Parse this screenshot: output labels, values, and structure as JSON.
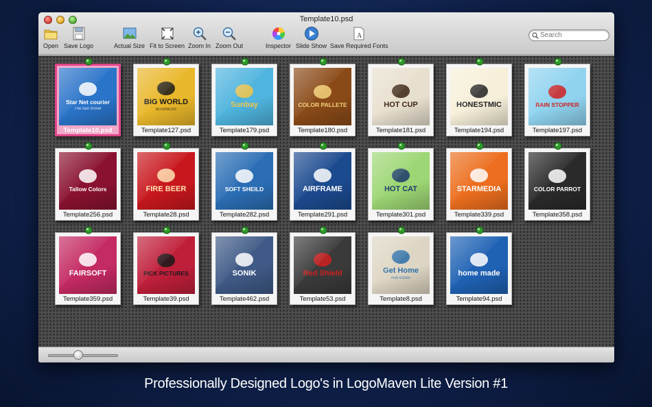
{
  "window": {
    "title": "Template10.psd"
  },
  "toolbar": {
    "buttons": [
      {
        "label": "Open",
        "icon": "folder-icon"
      },
      {
        "label": "Save Logo",
        "icon": "save-icon"
      },
      {
        "label": "Actual Size",
        "icon": "actual-size-icon"
      },
      {
        "label": "Fit to Screen",
        "icon": "fit-screen-icon"
      },
      {
        "label": "Zoom In",
        "icon": "zoom-in-icon"
      },
      {
        "label": "Zoom Out",
        "icon": "zoom-out-icon"
      },
      {
        "label": "Inspector",
        "icon": "color-wheel-icon"
      },
      {
        "label": "Slide Show",
        "icon": "play-icon"
      },
      {
        "label": "Save Required Fonts",
        "icon": "font-document-icon"
      }
    ]
  },
  "search": {
    "placeholder": "Search"
  },
  "templates": [
    {
      "file": "Template10.psd",
      "logo": "Star Net courier",
      "tagline": "The fast mover",
      "bg": "#2a74c9",
      "fg": "#ffffff",
      "selected": true
    },
    {
      "file": "Template127.psd",
      "logo": "BIG WORLD",
      "tagline": "BUSINESS",
      "bg": "#e9b72a",
      "fg": "#1b1b1b"
    },
    {
      "file": "Template179.psd",
      "logo": "Sunbay",
      "tagline": "",
      "bg": "#4fb4de",
      "fg": "#f2c54a"
    },
    {
      "file": "Template180.psd",
      "logo": "COLOR PALLETE",
      "tagline": "",
      "bg": "#8a4a18",
      "fg": "#f5d27a"
    },
    {
      "file": "Template181.psd",
      "logo": "HOT CUP",
      "tagline": "",
      "bg": "#e8e0cf",
      "fg": "#3b2414"
    },
    {
      "file": "Template194.psd",
      "logo": "HONESTMIC",
      "tagline": "",
      "bg": "#f6efd9",
      "fg": "#222222"
    },
    {
      "file": "Template197.psd",
      "logo": "RAIN STOPPER",
      "tagline": "",
      "bg": "#8fd3ef",
      "fg": "#d02020"
    },
    {
      "file": "Template256.psd",
      "logo": "Tallow Colors",
      "tagline": "",
      "bg": "#8a1230",
      "fg": "#ffffff"
    },
    {
      "file": "Template28.psd",
      "logo": "FIRE BEER",
      "tagline": "",
      "bg": "#c8181e",
      "fg": "#ffe2b0"
    },
    {
      "file": "Template282.psd",
      "logo": "SOFT SHEILD",
      "tagline": "",
      "bg": "#2b6eb5",
      "fg": "#ffffff"
    },
    {
      "file": "Template291.psd",
      "logo": "AIRFRAME",
      "tagline": "",
      "bg": "#1c4a8f",
      "fg": "#ffffff"
    },
    {
      "file": "Template301.psd",
      "logo": "HOT CAT",
      "tagline": "",
      "bg": "#9dd674",
      "fg": "#1d3a6b"
    },
    {
      "file": "Template339.psd",
      "logo": "STARMEDIA",
      "tagline": "",
      "bg": "#ec6e1e",
      "fg": "#ffffff"
    },
    {
      "file": "Template358.psd",
      "logo": "COLOR PARROT",
      "tagline": "",
      "bg": "#2a2a2a",
      "fg": "#ffffff"
    },
    {
      "file": "Template359.psd",
      "logo": "FAIRSOFT",
      "tagline": "",
      "bg": "#c42a63",
      "fg": "#ffffff"
    },
    {
      "file": "Template39.psd",
      "logo": "PICK PICTURES",
      "tagline": "",
      "bg": "#c01f3a",
      "fg": "#1a1a1a"
    },
    {
      "file": "Template462.psd",
      "logo": "SONIK",
      "tagline": "",
      "bg": "#3f5a86",
      "fg": "#ffffff"
    },
    {
      "file": "Template53.psd",
      "logo": "Red Shield",
      "tagline": "",
      "bg": "#3a3a3a",
      "fg": "#d02020"
    },
    {
      "file": "Template8.psd",
      "logo": "Get Home",
      "tagline": "real estate",
      "bg": "#ded6c4",
      "fg": "#2a6fa8"
    },
    {
      "file": "Template94.psd",
      "logo": "home made",
      "tagline": "",
      "bg": "#1f62b4",
      "fg": "#ffffff"
    }
  ],
  "footer": {
    "caption": "Professionally Designed Logo's in LogoMaven Lite Version #1"
  },
  "colors": {
    "selection": "#e0468a",
    "pin": "#2f9a2a"
  }
}
